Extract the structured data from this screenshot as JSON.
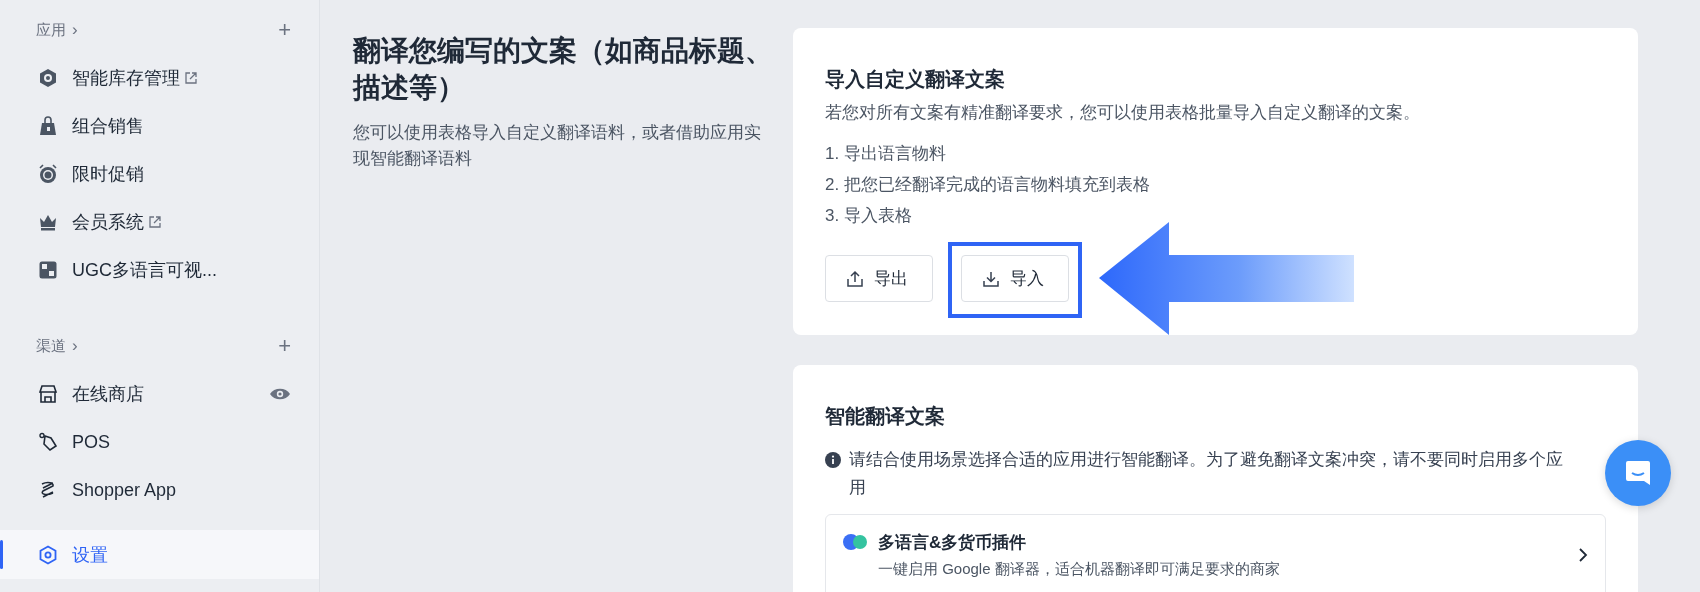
{
  "sidebar": {
    "sections": [
      {
        "title": "应用",
        "chevron": "›",
        "add": "+",
        "items": [
          {
            "label": "智能库存管理",
            "external": true,
            "preview": false,
            "selected": false
          },
          {
            "label": "组合销售",
            "external": false,
            "preview": false,
            "selected": false
          },
          {
            "label": "限时促销",
            "external": false,
            "preview": false,
            "selected": false
          },
          {
            "label": "会员系统",
            "external": true,
            "preview": false,
            "selected": false
          },
          {
            "label": "UGC多语言可视...",
            "external": false,
            "preview": false,
            "selected": false
          }
        ]
      },
      {
        "title": "渠道",
        "chevron": "›",
        "add": "+",
        "items": [
          {
            "label": "在线商店",
            "external": false,
            "preview": true,
            "selected": false
          },
          {
            "label": "POS",
            "external": false,
            "preview": false,
            "selected": false
          },
          {
            "label": "Shopper App",
            "external": false,
            "preview": false,
            "selected": false
          }
        ]
      }
    ],
    "settings": {
      "label": "设置",
      "selected": true
    }
  },
  "intro": {
    "title": "翻译您编写的文案（如商品标题、描述等）",
    "description": "您可以使用表格导入自定义翻译语料，或者借助应用实现智能翻译语料"
  },
  "import_card": {
    "title": "导入自定义翻译文案",
    "description": "若您对所有文案有精准翻译要求，您可以使用表格批量导入自定义翻译的文案。",
    "steps": [
      "1. 导出语言物料",
      "2. 把您已经翻译完成的语言物料填充到表格",
      "3. 导入表格"
    ],
    "buttons": [
      {
        "label": "导出",
        "kind": "export",
        "highlighted": false
      },
      {
        "label": "导入",
        "kind": "import",
        "highlighted": true
      }
    ]
  },
  "smart_card": {
    "title": "智能翻译文案",
    "notice": "请结合使用场景选择合适的应用进行智能翻译。为了避免翻译文案冲突，请不要同时启用多个应用",
    "apps": [
      {
        "title": "多语言&多货币插件",
        "description": "一键启用 Google 翻译器，适合机器翻译即可满足要求的商家"
      }
    ]
  }
}
